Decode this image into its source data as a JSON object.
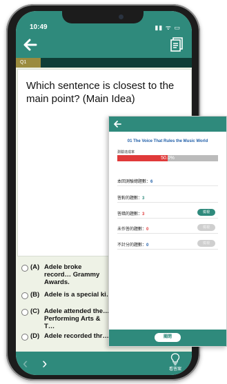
{
  "status": {
    "time": "10:49",
    "icons": "▮▮ ᯤ ▭"
  },
  "question": {
    "number_label": "Q1",
    "text": "Which sentence is closest to the main point? (Main Idea)",
    "options": [
      {
        "key": "(A)",
        "text": "Adele broke record… Grammy Awards."
      },
      {
        "key": "(B)",
        "text": "Adele is a special ki…"
      },
      {
        "key": "(C)",
        "text": "Adele attended the… Performing Arts & T…"
      },
      {
        "key": "(D)",
        "text": "Adele recorded thr…"
      }
    ]
  },
  "bottom": {
    "prev": "‹",
    "next": "›",
    "hint_label": "看答案"
  },
  "panel": {
    "title": "01 The Voice That Rules the Music World",
    "rate_label": "測驗達成率",
    "rate_value": 0.5,
    "rate_text": "50.0%",
    "stats": [
      {
        "label": "本回測驗總題數：",
        "value": "6",
        "value_color": "#1f5ea8",
        "button": null
      },
      {
        "label": "答對的題數：",
        "value": "3",
        "value_color": "#2f8a7c",
        "button": null
      },
      {
        "label": "答錯的題數：",
        "value": "3",
        "value_color": "#e03a3a",
        "button": {
          "label": "檢視",
          "active": true
        }
      },
      {
        "label": "未作答的題數：",
        "value": "0",
        "value_color": "#e03a3a",
        "button": {
          "label": "檢視",
          "active": false
        }
      },
      {
        "label": "不計分的題數：",
        "value": "0",
        "value_color": "#1f5ea8",
        "button": {
          "label": "檢視",
          "active": false
        }
      }
    ],
    "close_label": "關閉"
  },
  "colors": {
    "primary": "#2f8a7c",
    "dark": "#0e3d36",
    "accent": "#9a8b3e",
    "wrong": "#e03a3a",
    "title": "#1f5ea8"
  }
}
